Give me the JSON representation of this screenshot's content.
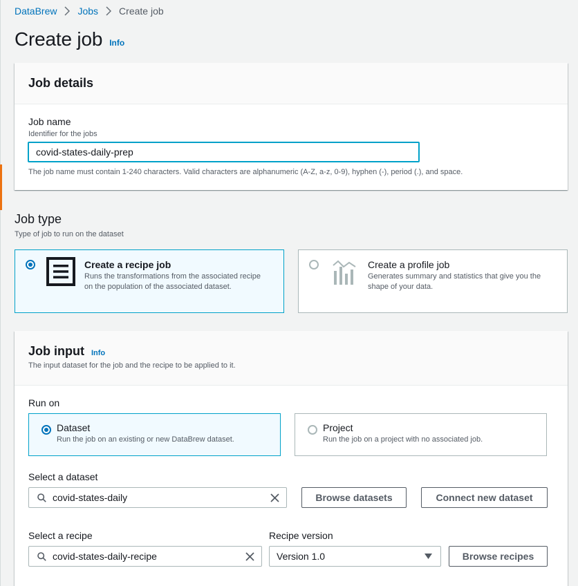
{
  "breadcrumb": {
    "root": "DataBrew",
    "jobs": "Jobs",
    "current": "Create job"
  },
  "page": {
    "title": "Create job",
    "info": "Info"
  },
  "job_details": {
    "heading": "Job details",
    "name_label": "Job name",
    "name_desc": "Identifier for the jobs",
    "name_value": "covid-states-daily-prep",
    "name_hint": "The job name must contain 1-240 characters. Valid characters are alphanumeric (A-Z, a-z, 0-9), hyphen (-), period (.), and space."
  },
  "job_type": {
    "heading": "Job type",
    "desc": "Type of job to run on the dataset",
    "options": [
      {
        "title": "Create a recipe job",
        "desc": "Runs the transformations from the associated recipe on the population of the associated dataset.",
        "selected": true
      },
      {
        "title": "Create a profile job",
        "desc": "Generates summary and statistics that give you the shape of your data.",
        "selected": false
      }
    ]
  },
  "job_input": {
    "heading": "Job input",
    "info": "Info",
    "desc": "The input dataset for the job and the recipe to be applied to it.",
    "run_on_label": "Run on",
    "run_on_options": [
      {
        "title": "Dataset",
        "desc": "Run the job on an existing or new DataBrew dataset.",
        "selected": true
      },
      {
        "title": "Project",
        "desc": "Run the job on a project with no associated job.",
        "selected": false
      }
    ],
    "dataset_label": "Select a dataset",
    "dataset_value": "covid-states-daily",
    "browse_datasets": "Browse datasets",
    "connect_dataset": "Connect new dataset",
    "recipe_label": "Select a recipe",
    "recipe_value": "covid-states-daily-recipe",
    "version_label": "Recipe version",
    "version_value": "Version 1.0",
    "browse_recipes": "Browse recipes"
  },
  "colors": {
    "link": "#0073bb",
    "focus": "#00a1c9",
    "accent": "#ec7211"
  }
}
